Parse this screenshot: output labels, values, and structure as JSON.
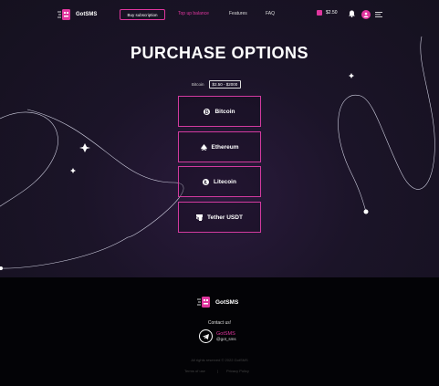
{
  "nav": {
    "logo": "GotSMS",
    "buy_subscription": "Buy subscription",
    "top_up": "Top up balance",
    "features": "Features",
    "faq": "FAQ",
    "balance": "$2.50"
  },
  "main": {
    "title": "PURCHASE OPTIONS",
    "filter_label": "Bitcoin",
    "filter_value": "$2.50 - $2000",
    "options": [
      {
        "label": "Bitcoin",
        "icon": "bitcoin-icon"
      },
      {
        "label": "Ethereum",
        "icon": "ethereum-icon"
      },
      {
        "label": "Litecoin",
        "icon": "litecoin-icon"
      },
      {
        "label": "Tether USDT",
        "icon": "tether-icon"
      }
    ]
  },
  "footer": {
    "logo": "GotSMS",
    "contact": "Contact us!",
    "telegram_name": "GotSMS",
    "telegram_handle": "@got_sms",
    "rights": "All rights reserved © 2022 GotSMS",
    "terms": "Terms of use",
    "privacy": "Privacy Policy"
  },
  "colors": {
    "accent": "#e0369e",
    "background": "#15111f",
    "footer": "#030306"
  }
}
